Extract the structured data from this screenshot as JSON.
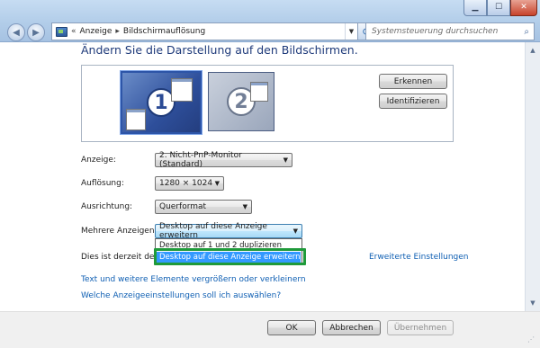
{
  "window": {
    "minimize_icon": "minimize-icon",
    "maximize_icon": "maximize-icon",
    "close_icon": "close-icon",
    "minimize_glyph": "▁",
    "maximize_glyph": "☐",
    "close_glyph": "✕"
  },
  "nav": {
    "back_glyph": "◀",
    "forward_glyph": "▶",
    "refresh_glyph": "⟳"
  },
  "address": {
    "breadcrumbs": [
      "Anzeige",
      "Bildschirmauflösung"
    ],
    "separator": "▸",
    "root_separator": "«",
    "dropdown_glyph": "▼"
  },
  "search": {
    "placeholder": "Systemsteuerung durchsuchen",
    "icon": "search-icon",
    "glyph": "⌕"
  },
  "main": {
    "heading": "Ändern Sie die Darstellung auf den Bildschirmen.",
    "monitors": [
      {
        "number": "1",
        "selected": true
      },
      {
        "number": "2",
        "selected": false
      }
    ],
    "detect_button": "Erkennen",
    "identify_button": "Identifizieren",
    "rows": [
      {
        "label": "Anzeige:",
        "value": "2. Nicht-PnP-Monitor (Standard)"
      },
      {
        "label": "Auflösung:",
        "value": "1280 × 1024"
      },
      {
        "label": "Ausrichtung:",
        "value": "Querformat"
      },
      {
        "label": "Mehrere Anzeigen:",
        "value": "Desktop auf diese Anzeige erweitern"
      }
    ],
    "caret_glyph": "▼",
    "dropdown_options": [
      "Desktop auf 1 und 2 duplizieren",
      "Desktop auf diese Anzeige erweitern"
    ],
    "selected_option_index": 1,
    "status_text": "Dies ist derzeit der H",
    "advanced_link": "Erweiterte Einstellungen",
    "links": [
      "Text und weitere Elemente vergrößern oder verkleinern",
      "Welche Anzeigeeinstellungen soll ich auswählen?"
    ]
  },
  "footer": {
    "ok": "OK",
    "cancel": "Abbrechen",
    "apply": "Übernehmen",
    "apply_enabled": false
  },
  "scrollbar": {
    "up_glyph": "▲",
    "down_glyph": "▼"
  },
  "colors": {
    "accent": "#1e3a7a",
    "link": "#0f5fb3",
    "selection": "#3399ff",
    "highlight_box": "#1f9a3a"
  }
}
